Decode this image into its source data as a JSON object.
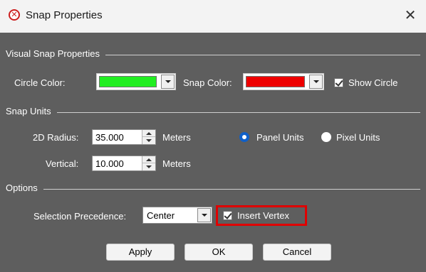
{
  "window": {
    "title": "Snap Properties",
    "close_glyph": "✕"
  },
  "visual_snap": {
    "section_label": "Visual Snap Properties",
    "circle_color_label": "Circle Color:",
    "circle_color": "#22ee22",
    "snap_color_label": "Snap Color:",
    "snap_color": "#ee0000",
    "show_circle_label": "Show Circle",
    "show_circle_checked": true
  },
  "snap_units": {
    "section_label": "Snap Units",
    "radius_label": "2D Radius:",
    "radius_value": "35.000",
    "radius_unit": "Meters",
    "vertical_label": "Vertical:",
    "vertical_value": "10.000",
    "vertical_unit": "Meters",
    "panel_units_label": "Panel Units",
    "pixel_units_label": "Pixel Units",
    "selected_unit": "Panel Units"
  },
  "options": {
    "section_label": "Options",
    "precedence_label": "Selection Precedence:",
    "precedence_value": "Center",
    "insert_vertex_label": "Insert Vertex",
    "insert_vertex_checked": true
  },
  "buttons": {
    "apply": "Apply",
    "ok": "OK",
    "cancel": "Cancel"
  },
  "colors": {
    "dialog_bg": "#5e5e5e",
    "highlight": "#e00000",
    "radio_accent": "#1060c8"
  }
}
